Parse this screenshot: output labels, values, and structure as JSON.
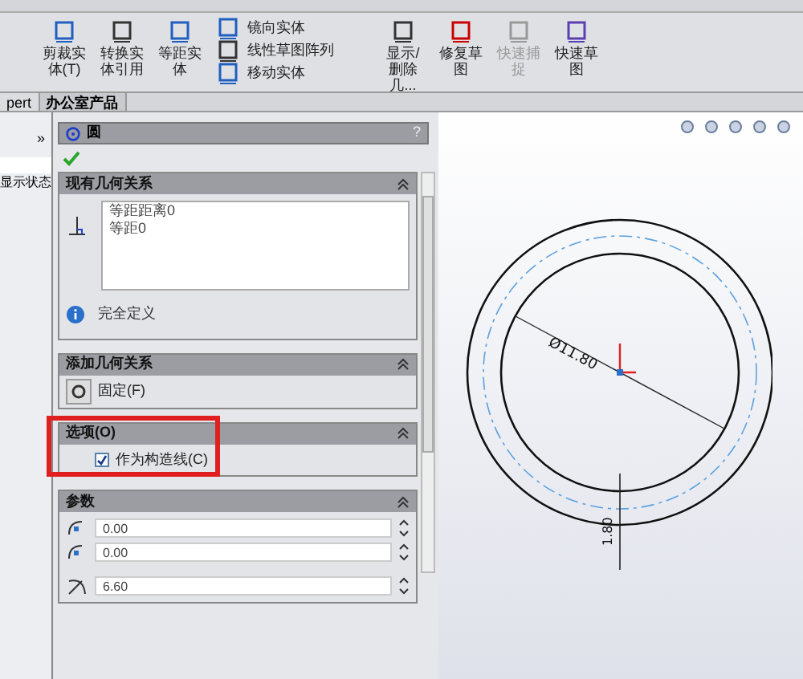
{
  "toolbar": {
    "items": [
      {
        "label": "剪裁实体(T)",
        "kind": "big",
        "disabled": false
      },
      {
        "label": "转换实体引用",
        "kind": "big",
        "disabled": false
      },
      {
        "label": "等距实体",
        "kind": "big",
        "disabled": false
      },
      {
        "kind": "stack",
        "items": [
          {
            "label": "镜向实体"
          },
          {
            "label": "线性草图阵列"
          },
          {
            "label": "移动实体"
          }
        ]
      },
      {
        "label": "显示/删除几...",
        "kind": "big",
        "disabled": false
      },
      {
        "label": "修复草图",
        "kind": "big",
        "disabled": false
      },
      {
        "label": "快速捕捉",
        "kind": "big",
        "disabled": true
      },
      {
        "label": "快速草图",
        "kind": "big",
        "disabled": false
      }
    ]
  },
  "tabs": [
    {
      "label": "pert",
      "selected": false
    },
    {
      "label": "办公室产品",
      "selected": true
    }
  ],
  "left_pane": {
    "expand": "»",
    "item": "显示状态"
  },
  "property_manager": {
    "title": "圆",
    "help": "?",
    "sections": [
      {
        "kind": "relations",
        "title": "现有几何关系",
        "relations": [
          "等距距离0",
          "等距0"
        ],
        "status": "完全定义"
      },
      {
        "kind": "add",
        "title": "添加几何关系",
        "button": "固定(F)"
      },
      {
        "kind": "options",
        "title": "选项(O)",
        "highlighted": true,
        "checkbox": {
          "label": "作为构造线(C)",
          "checked": true
        }
      },
      {
        "kind": "params",
        "title": "参数",
        "fields": [
          {
            "value": "0.00",
            "kind": "point"
          },
          {
            "value": "0.00",
            "kind": "point"
          },
          {
            "value": "6.60",
            "kind": "radius"
          }
        ]
      }
    ]
  },
  "drawing": {
    "diameter": "Ø11.80",
    "thickness": "1.80"
  }
}
